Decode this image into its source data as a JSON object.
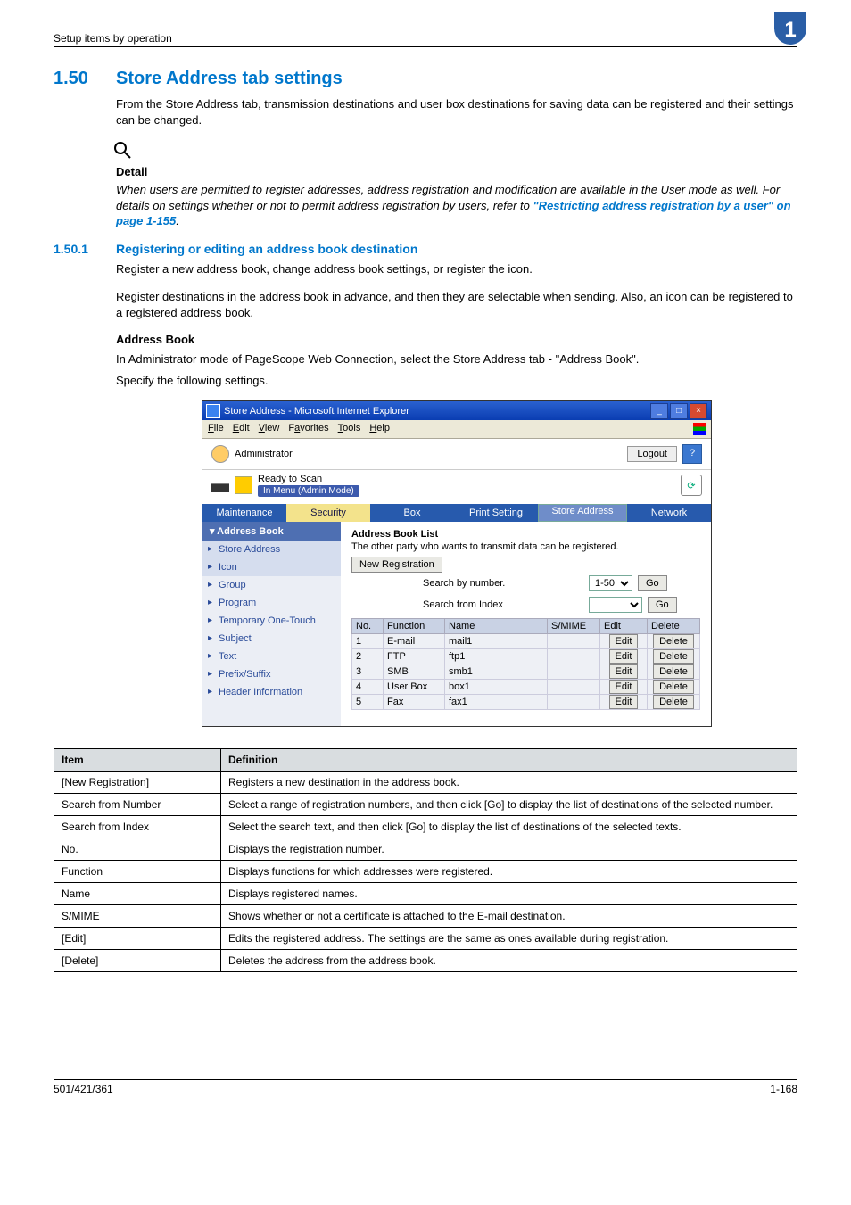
{
  "header": {
    "section_path": "Setup items by operation",
    "chapter_no": "1"
  },
  "sect": {
    "num": "1.50",
    "title": "Store Address tab settings",
    "intro": "From the Store Address tab, transmission destinations and user box destinations for saving data can be registered and their settings can be changed."
  },
  "detail": {
    "label": "Detail",
    "body_before": "When users are permitted to register addresses, address registration and modification are available in the User mode as well. For details on settings whether or not to permit address registration by users, refer to ",
    "link": "\"Restricting address registration by a user\" on page 1-155",
    "body_after": "."
  },
  "subsect": {
    "num": "1.50.1",
    "title": "Registering or editing an address book destination",
    "p1": "Register a new address book, change address book settings, or register the icon.",
    "p2": "Register destinations in the address book in advance, and then they are selectable when sending. Also, an icon can be registered to a registered address book.",
    "h_addrbook": "Address Book",
    "p3": "In Administrator mode of PageScope Web Connection, select the Store Address tab - \"Address Book\".",
    "p4": "Specify the following settings."
  },
  "shot": {
    "window_title": "Store Address - Microsoft Internet Explorer",
    "menus": {
      "file": "File",
      "edit": "Edit",
      "view": "View",
      "favorites": "Favorites",
      "tools": "Tools",
      "help": "Help"
    },
    "admin_label": "Administrator",
    "logout": "Logout",
    "status_ready": "Ready to Scan",
    "status_menu": "In Menu (Admin Mode)",
    "tabs": [
      "Maintenance",
      "Security",
      "Box",
      "Print Setting",
      "Store Address",
      "Network"
    ],
    "sidebar": {
      "head": "Address Book",
      "items": [
        "Store Address",
        "Icon",
        "Group",
        "Program",
        "Temporary One-Touch",
        "Subject",
        "Text",
        "Prefix/Suffix",
        "Header Information"
      ]
    },
    "pane": {
      "head": "Address Book List",
      "sub": "The other party who wants to transmit data can be registered.",
      "new_reg": "New Registration",
      "search_num_label": "Search by number.",
      "search_num_val": "1-50",
      "search_idx_label": "Search from Index",
      "go": "Go",
      "cols": [
        "No.",
        "Function",
        "Name",
        "S/MIME",
        "Edit",
        "Delete"
      ],
      "rows": [
        {
          "no": "1",
          "fn": "E-mail",
          "name": "mail1",
          "edit": "Edit",
          "del": "Delete"
        },
        {
          "no": "2",
          "fn": "FTP",
          "name": "ftp1",
          "edit": "Edit",
          "del": "Delete"
        },
        {
          "no": "3",
          "fn": "SMB",
          "name": "smb1",
          "edit": "Edit",
          "del": "Delete"
        },
        {
          "no": "4",
          "fn": "User Box",
          "name": "box1",
          "edit": "Edit",
          "del": "Delete"
        },
        {
          "no": "5",
          "fn": "Fax",
          "name": "fax1",
          "edit": "Edit",
          "del": "Delete"
        }
      ]
    }
  },
  "def_table": {
    "head_item": "Item",
    "head_def": "Definition",
    "rows": [
      {
        "item": "[New Registration]",
        "def": "Registers a new destination in the address book."
      },
      {
        "item": "Search from Number",
        "def": "Select a range of registration numbers, and then click [Go] to display the list of destinations of the selected number."
      },
      {
        "item": "Search from Index",
        "def": "Select the search text, and then click [Go] to display the list of destinations of the selected texts."
      },
      {
        "item": "No.",
        "def": "Displays the registration number."
      },
      {
        "item": "Function",
        "def": "Displays functions for which addresses were registered."
      },
      {
        "item": "Name",
        "def": "Displays registered names."
      },
      {
        "item": "S/MIME",
        "def": "Shows whether or not a certificate is attached to the E-mail destination."
      },
      {
        "item": "[Edit]",
        "def": "Edits the registered address. The settings are the same as ones available during registration."
      },
      {
        "item": "[Delete]",
        "def": "Deletes the address from the address book."
      }
    ]
  },
  "footer": {
    "left": "501/421/361",
    "right": "1-168"
  }
}
